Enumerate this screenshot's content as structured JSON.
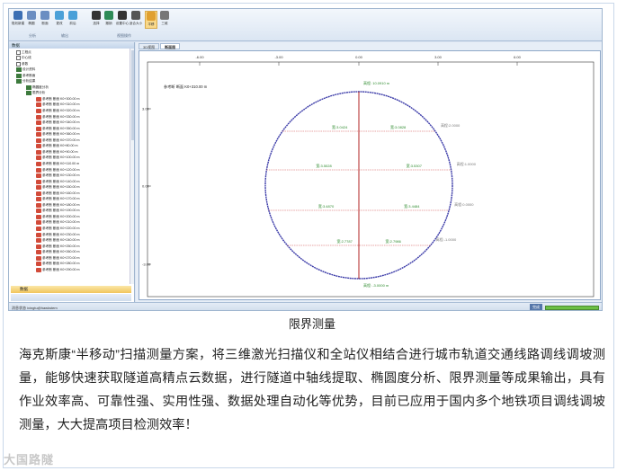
{
  "ribbon": {
    "buttons": [
      {
        "label": "规划新建",
        "icon": "tunnel-icon",
        "color": "#3c6fb4"
      },
      {
        "label": "椭圆",
        "icon": "ellipse-icon",
        "color": "#6b8ec2"
      },
      {
        "label": "断面",
        "icon": "section-icon",
        "color": "#6b8ec2"
      },
      {
        "label": "更改",
        "icon": "table-icon",
        "color": "#4aa0d8"
      },
      {
        "label": "前后",
        "icon": "arrow-icon",
        "color": "#4aa0d8"
      },
      {
        "label": "选择",
        "icon": "cursor-icon",
        "color": "#333333"
      },
      {
        "label": "撤销",
        "icon": "undo-icon",
        "color": "#2e8b57"
      },
      {
        "label": "设置中心",
        "icon": "target-icon",
        "color": "#333333"
      },
      {
        "label": "适合大小",
        "icon": "fit-icon",
        "color": "#555555"
      },
      {
        "label": "平移",
        "icon": "pan-icon",
        "color": "#e0a030"
      },
      {
        "label": "三维",
        "icon": "cube-icon",
        "color": "#777777"
      }
    ],
    "groups": [
      "分析",
      "输出",
      "视图操作"
    ]
  },
  "left_panel": {
    "header": "数据",
    "tree": [
      {
        "level": 0,
        "label": "工程点",
        "icon": "box"
      },
      {
        "level": 0,
        "label": "中心线",
        "icon": "box"
      },
      {
        "level": 0,
        "label": "参数",
        "icon": "box"
      },
      {
        "level": 0,
        "label": "设计资料",
        "icon": "folder"
      },
      {
        "level": 0,
        "label": "参考断面",
        "icon": "folder"
      },
      {
        "level": 0,
        "label": "分析结果",
        "icon": "folder"
      },
      {
        "level": 1,
        "label": "椭圆度分析",
        "icon": "folder"
      },
      {
        "level": 1,
        "label": "限界分析",
        "icon": "folder"
      },
      {
        "level": 2,
        "label": "参考断 断面 K0+300.00 m",
        "icon": "file"
      },
      {
        "level": 2,
        "label": "参考断 断面 K0+310.00 m",
        "icon": "file"
      },
      {
        "level": 2,
        "label": "参考断 断面 K0+320.00 m",
        "icon": "file"
      },
      {
        "level": 2,
        "label": "参考断 断面 K0+330.00 m",
        "icon": "file"
      },
      {
        "level": 2,
        "label": "参考断 断面 K0+340.00 m",
        "icon": "file"
      },
      {
        "level": 2,
        "label": "参考断 断面 K0+350.00 m",
        "icon": "file"
      },
      {
        "level": 2,
        "label": "参考断 断面 K0+360.00 m",
        "icon": "file"
      },
      {
        "level": 2,
        "label": "参考断 断面 K0+370.00 m",
        "icon": "file"
      },
      {
        "level": 2,
        "label": "参考断 断面 K0+80.00 m",
        "icon": "file"
      },
      {
        "level": 2,
        "label": "参考断 断面 K0+90.00 m",
        "icon": "file"
      },
      {
        "level": 2,
        "label": "参考断 断面 K0+100.00 m",
        "icon": "file"
      },
      {
        "level": 2,
        "label": "参考断 断面 K0+110.00 m",
        "icon": "file"
      },
      {
        "level": 2,
        "label": "参考断 断面 K0+120.00 m",
        "icon": "file"
      },
      {
        "level": 2,
        "label": "参考断 断面 K0+130.00 m",
        "icon": "file"
      },
      {
        "level": 2,
        "label": "参考断 断面 K0+140.00 m",
        "icon": "file"
      },
      {
        "level": 2,
        "label": "参考断 断面 K0+150.00 m",
        "icon": "file"
      },
      {
        "level": 2,
        "label": "参考断 断面 K0+160.00 m",
        "icon": "file"
      },
      {
        "level": 2,
        "label": "参考断 断面 K0+170.00 m",
        "icon": "file"
      },
      {
        "level": 2,
        "label": "参考断 断面 K0+180.00 m",
        "icon": "file"
      },
      {
        "level": 2,
        "label": "参考断 断面 K0+190.00 m",
        "icon": "file"
      },
      {
        "level": 2,
        "label": "参考断 断面 K0+200.00 m",
        "icon": "file"
      },
      {
        "level": 2,
        "label": "参考断 断面 K0+210.00 m",
        "icon": "file"
      },
      {
        "level": 2,
        "label": "参考断 断面 K0+220.00 m",
        "icon": "file"
      },
      {
        "level": 2,
        "label": "参考断 断面 K0+230.00 m",
        "icon": "file"
      },
      {
        "level": 2,
        "label": "参考断 断面 K0+240.00 m",
        "icon": "file"
      },
      {
        "level": 2,
        "label": "参考断 断面 K0+250.00 m",
        "icon": "file"
      },
      {
        "level": 2,
        "label": "参考断 断面 K0+260.00 m",
        "icon": "file"
      },
      {
        "level": 2,
        "label": "参考断 断面 K0+270.00 m",
        "icon": "file"
      },
      {
        "level": 2,
        "label": "参考断 断面 K0+280.00 m",
        "icon": "file"
      },
      {
        "level": 2,
        "label": "参考断 断面 K0+290.00 m",
        "icon": "file"
      }
    ],
    "bottom_button": "数据"
  },
  "tabs": [
    {
      "label": "3D视图"
    },
    {
      "label": "断面图"
    }
  ],
  "section_view": {
    "title": "参考断 断面 K0+310.00 m",
    "x_ticks": [
      "-6.00",
      "-3.00",
      "0.00",
      "3.00",
      "6.00"
    ],
    "y_ticks": [
      "3.00",
      "0.00",
      "-3.00"
    ],
    "top_label": "高程: 10.0910 m",
    "bottom_label": "高程: -3.0000 m",
    "rows": [
      {
        "left": "宽:3.0424",
        "right": "宽:3.0828",
        "elev": "高程:2.0000"
      },
      {
        "left": "宽:3.5028",
        "right": "宽:3.5307",
        "elev": "高程:1.0000"
      },
      {
        "left": "宽:3.4870",
        "right": "宽:3.4484",
        "elev": "高程:0.0000"
      },
      {
        "left": "宽:2.7787",
        "right": "宽:2.7986",
        "elev": "高程:-1.0000"
      }
    ],
    "colors": {
      "circle": "#3b3ba8",
      "axis": "#b02020",
      "label": "#2e8b2e"
    }
  },
  "status": {
    "text": "消息状态 ixingtu@hawkstem",
    "progress_label": "完成",
    "progress": 1.0
  },
  "caption": "限界测量",
  "paragraph": "海克斯康“半移动”扫描测量方案，将三维激光扫描仪和全站仪相结合进行城市轨道交通线路调线调坡测量，能够快速获取隧道高精点云数据，进行隧道中轴线提取、椭圆度分析、限界测量等成果输出，具有作业效率高、可靠性强、实用性强、数据处理自动化等优势，目前已应用于国内多个地铁项目调线调坡测量，大大提高项目检测效率！",
  "watermark": "大国路隧"
}
